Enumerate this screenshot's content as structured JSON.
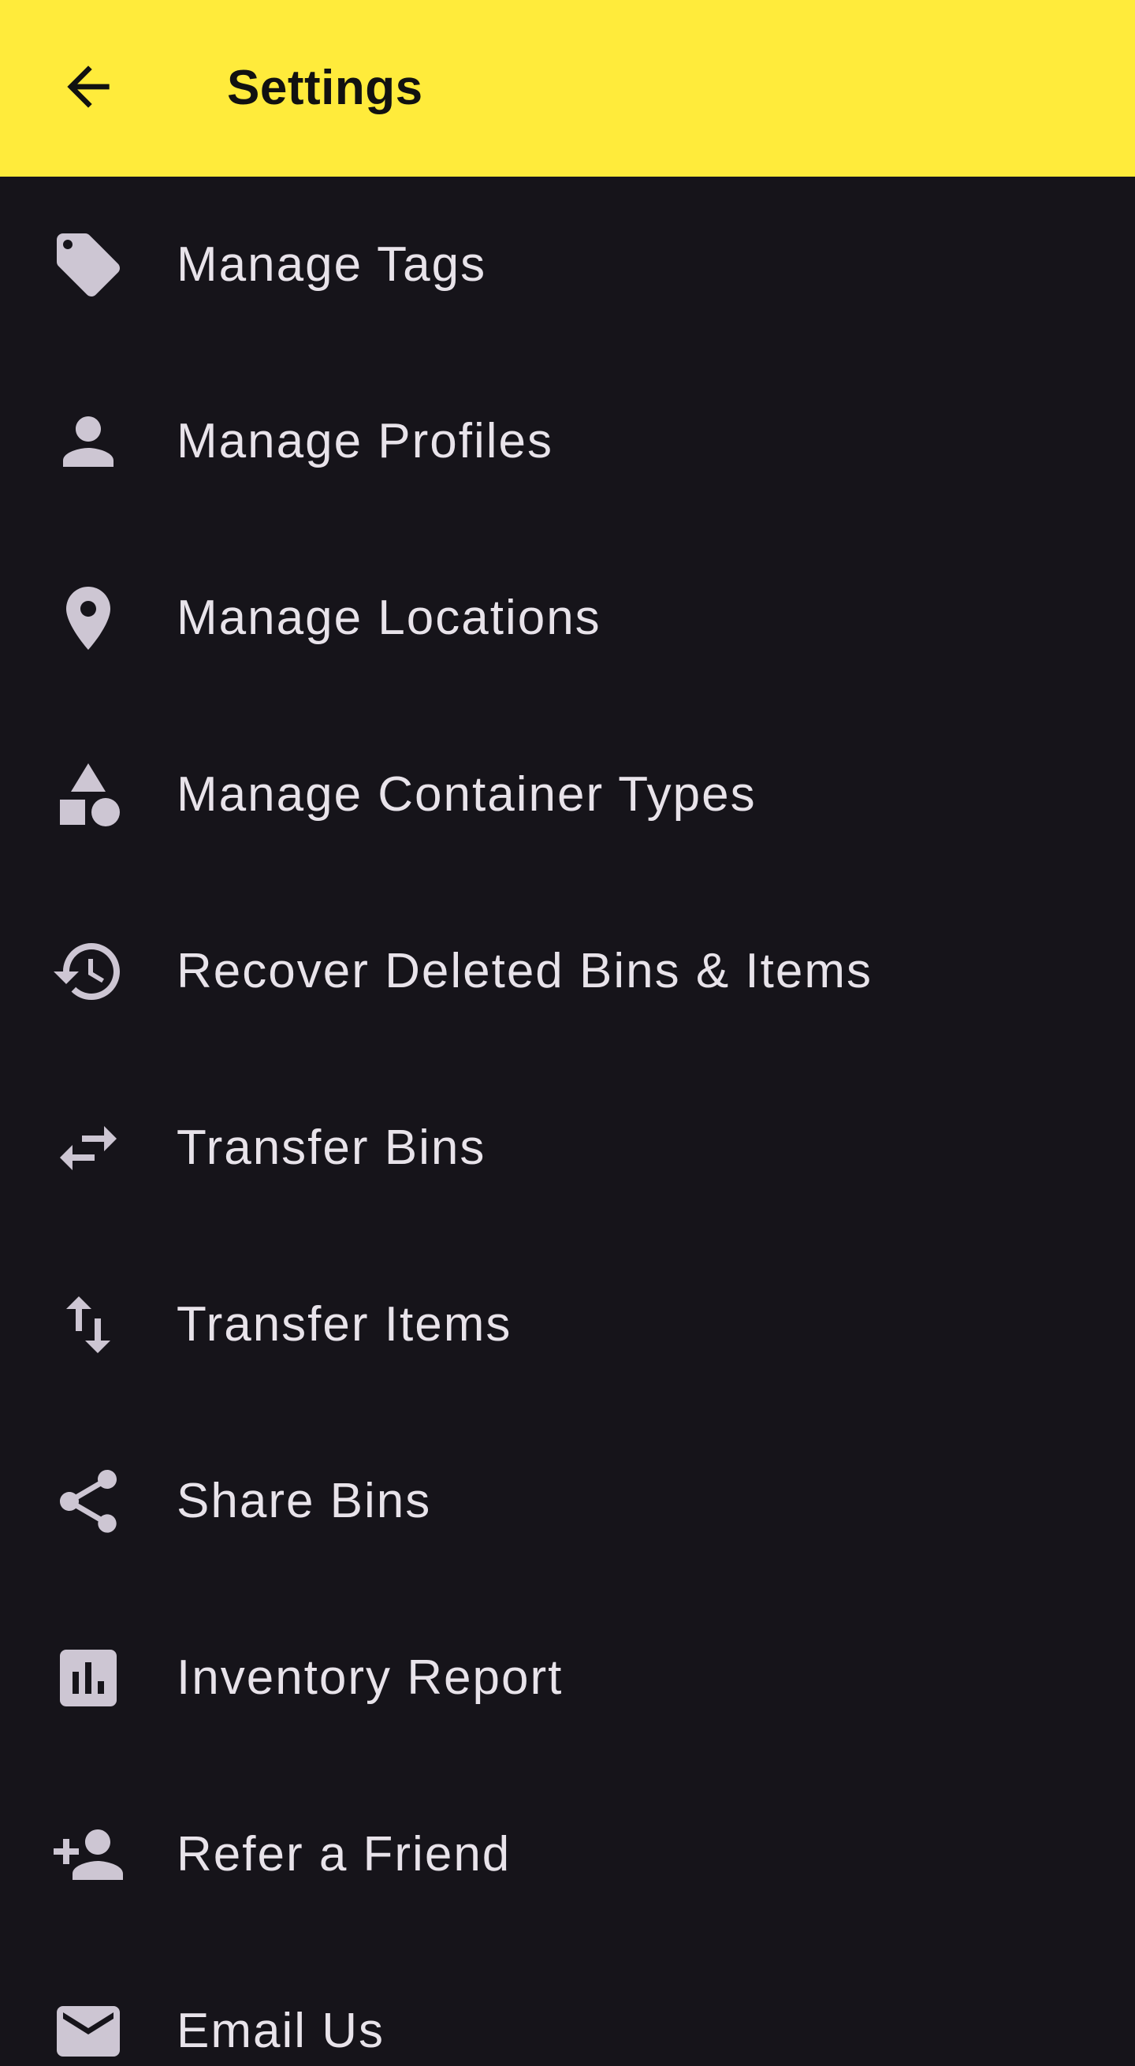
{
  "appbar": {
    "back_icon": "arrow-back-icon",
    "title": "Settings",
    "background": "#ffeb3b"
  },
  "theme": {
    "background": "#16141a",
    "icon_color": "#cdc6d3",
    "text_color": "#e8e3ea"
  },
  "menu": {
    "items": [
      {
        "label": "Manage Tags",
        "icon": "tag-icon"
      },
      {
        "label": "Manage Profiles",
        "icon": "person-icon"
      },
      {
        "label": "Manage Locations",
        "icon": "location-pin-icon"
      },
      {
        "label": "Manage Container Types",
        "icon": "shapes-icon"
      },
      {
        "label": "Recover Deleted Bins & Items",
        "icon": "history-icon"
      },
      {
        "label": "Transfer Bins",
        "icon": "swap-horiz-icon"
      },
      {
        "label": "Transfer Items",
        "icon": "swap-vert-icon"
      },
      {
        "label": "Share Bins",
        "icon": "share-icon"
      },
      {
        "label": "Inventory Report",
        "icon": "bar-chart-icon"
      },
      {
        "label": "Refer a Friend",
        "icon": "person-add-icon"
      },
      {
        "label": "Email Us",
        "icon": "mail-icon"
      }
    ]
  }
}
